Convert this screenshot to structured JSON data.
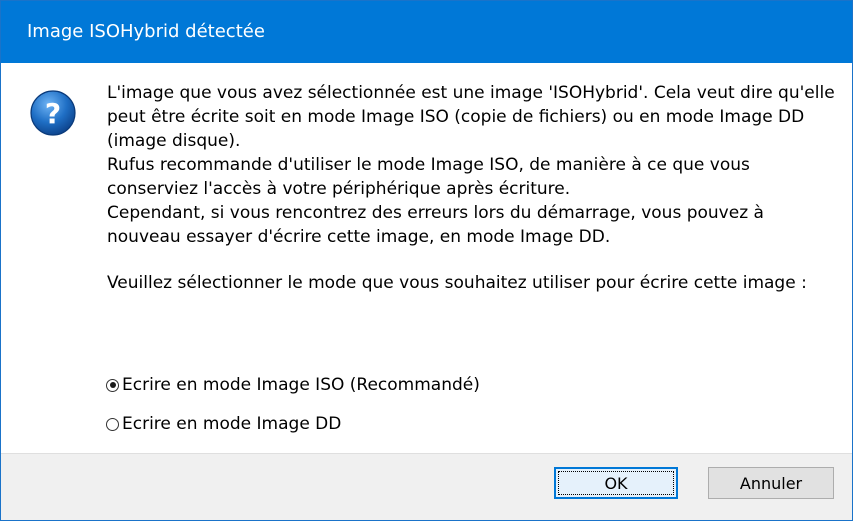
{
  "window": {
    "title": "Image ISOHybrid détectée"
  },
  "icon": {
    "name": "question-icon",
    "color": "#1f6fc5"
  },
  "message": {
    "paragraphs": [
      "L'image que vous avez sélectionnée est une image 'ISOHybrid'. Cela veut dire qu'elle peut être écrite soit en mode Image ISO (copie de fichiers) ou en mode Image DD (image disque).",
      "Rufus recommande d'utiliser le mode Image ISO, de manière à ce que vous conserviez l'accès à votre périphérique après écriture.",
      "Cependant, si vous rencontrez des erreurs lors du démarrage, vous pouvez à nouveau essayer d'écrire cette image, en mode Image DD."
    ],
    "prompt": "Veuillez sélectionner le mode que vous souhaitez utiliser pour écrire cette image :"
  },
  "options": [
    {
      "label": "Ecrire en mode Image ISO (Recommandé)",
      "checked": true
    },
    {
      "label": "Ecrire en mode Image DD",
      "checked": false
    }
  ],
  "buttons": {
    "ok": "OK",
    "cancel": "Annuler"
  }
}
